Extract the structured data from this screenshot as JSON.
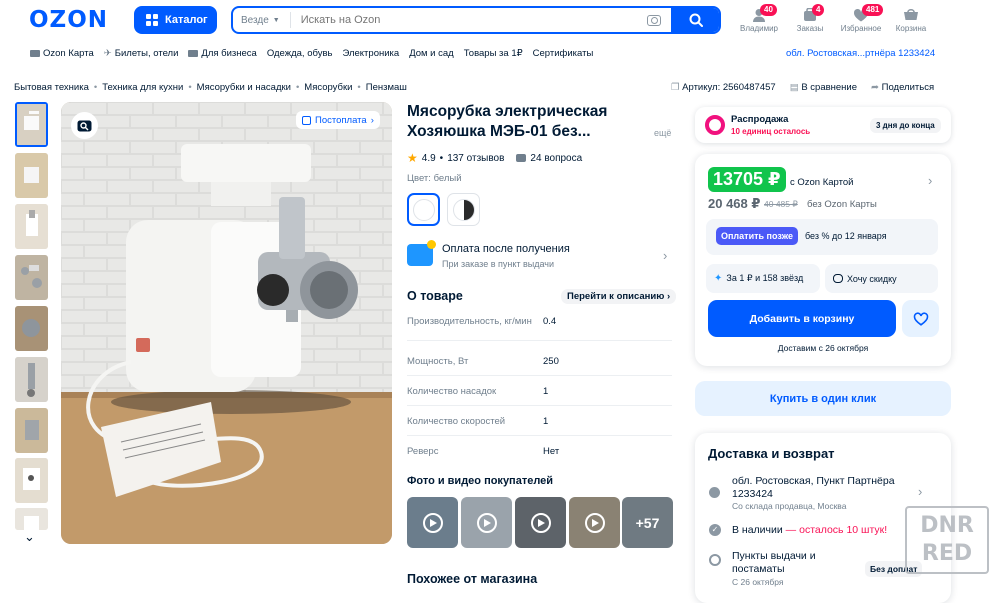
{
  "header": {
    "logo": "OZON",
    "catalog": "Каталог",
    "search_scope": "Везде",
    "search_placeholder": "Искать на Ozon",
    "icons": [
      {
        "label": "Владимир",
        "badge": "40",
        "icon": "user-icon"
      },
      {
        "label": "Заказы",
        "badge": "4",
        "icon": "box-icon"
      },
      {
        "label": "Избранное",
        "badge": "481",
        "icon": "heart-icon"
      },
      {
        "label": "Корзина",
        "badge": "",
        "icon": "cart-icon"
      }
    ]
  },
  "subnav": {
    "items": [
      "Ozon Карта",
      "Билеты, отели",
      "Для бизнеса",
      "Одежда, обувь",
      "Электроника",
      "Дом и сад",
      "Товары за 1₽",
      "Сертификаты"
    ],
    "location": "обл. Ростовская...ртнёра 1233424"
  },
  "breadcrumbs": [
    "Бытовая техника",
    "Техника для кухни",
    "Мясорубки и насадки",
    "Мясорубки",
    "Пензмаш"
  ],
  "meta": {
    "sku": "Артикул: 2560487457",
    "compare": "В сравнение",
    "share": "Поделиться"
  },
  "gallery": {
    "badge": "Постоплата",
    "count": 9
  },
  "product": {
    "title_line1": "Мясорубка электрическая",
    "title_line2": "Хозяюшка МЭБ-01 без...",
    "more": "ещё",
    "rating": "4.9",
    "reviews": "137 отзывов",
    "questions": "24 вопроса",
    "color_label": "Цвет: белый",
    "pay_after_title": "Оплата после получения",
    "pay_after_sub": "При заказе в пункт выдачи",
    "about_title": "О товаре",
    "to_description": "Перейти к описанию",
    "specs": [
      {
        "name": "Производительность, кг/мин",
        "value": "0.4"
      },
      {
        "name": "Мощность, Вт",
        "value": "250"
      },
      {
        "name": "Количество насадок",
        "value": "1"
      },
      {
        "name": "Количество скоростей",
        "value": "1"
      },
      {
        "name": "Реверс",
        "value": "Нет"
      }
    ],
    "photos_title": "Фото и видео покупателей",
    "photos_more": "+57",
    "similar_title": "Похожее от магазина"
  },
  "sale": {
    "title": "Распродажа",
    "sub": "10 единиц осталось",
    "days": "3 дня до конца"
  },
  "price": {
    "card_price": "13705 ₽",
    "card_label": "с Ozon Картой",
    "regular": "20 468 ₽",
    "old": "40 485 ₽",
    "regular_label": "без Ozon Карты",
    "pay_later": "Оплатить позже",
    "pay_later_sub": "без % до 12 января",
    "stars": "За 1 ₽ и 158 звёзд",
    "discount": "Хочу скидку",
    "add_to_cart": "Добавить в корзину",
    "deliver": "Доставим с 26 октября"
  },
  "one_click": "Купить в один клик",
  "delivery": {
    "title": "Доставка и возврат",
    "address_line1": "обл. Ростовская, Пункт Партнёра",
    "address_line2": "1233424",
    "warehouse": "Со склада продавца, Москва",
    "stock": "В наличии",
    "stock_left": " — осталось 10 штук!",
    "pickup_line1": "Пункты выдачи и",
    "pickup_line2": "постаматы",
    "pickup_date": "С 26 октября",
    "pickup_badge": "Без доплат"
  },
  "watermark": [
    "DNR",
    "RED"
  ],
  "colors": {
    "brand": "#005bff",
    "price_green": "#10c44c",
    "badge": "#f91155",
    "pay_later": "#4b59f7"
  }
}
